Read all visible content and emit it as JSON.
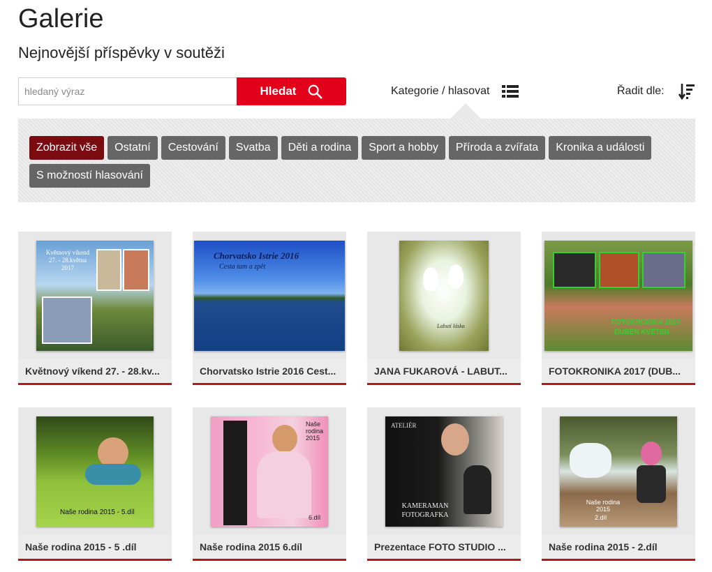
{
  "header": {
    "title": "Galerie",
    "subtitle": "Nejnovější příspěvky v soutěži"
  },
  "search": {
    "placeholder": "hledaný výraz",
    "value": "",
    "button_label": "Hledat"
  },
  "category_toggle": {
    "label": "Kategorie / hlasovat",
    "icon": "list-icon"
  },
  "sort": {
    "label": "Řadit dle:",
    "icon": "sort-descending-icon"
  },
  "filters": {
    "row1": [
      "Zobrazit vše",
      "Ostatní",
      "Cestování",
      "Svatba",
      "Děti a rodina",
      "Sport a hobby",
      "Příroda a zvířata",
      "Kronika a události"
    ],
    "row2": [
      "S možností hlasování"
    ],
    "active": "Zobrazit vše",
    "active_color": "#7a0b10",
    "chip_color": "#666666"
  },
  "colors": {
    "accent": "#e3001b",
    "card_underline": "#b01a1f"
  },
  "gallery": [
    {
      "caption": "Květnový víkend 27. - 28.kv...",
      "thumb_text": "Květnový víkend 27. - 28.května 2017"
    },
    {
      "caption": "Chorvatsko Istrie 2016 Cest...",
      "thumb_text": "Chorvatsko Istrie 2016",
      "thumb_subtext": "Cesta tam a zpět"
    },
    {
      "caption": "JANA FUKAROVÁ - LABUT...",
      "thumb_text": "Labutí láska"
    },
    {
      "caption": "FOTOKRONIKA 2017 (DUB...",
      "thumb_text": "FOTOKRONIKA 2017",
      "thumb_subtext": "DUBEN KVĚTEN"
    },
    {
      "caption": "Naše rodina 2015 - 5 .díl",
      "thumb_text": "Naše rodina 2015 - 5.díl"
    },
    {
      "caption": "Naše rodina 2015 6.díl",
      "thumb_text": "Naše rodina 2015",
      "thumb_subtext": "6.díl"
    },
    {
      "caption": "Prezentace FOTO STUDIO ...",
      "thumb_text": "KAMERAMAN FOTOGRAFKA",
      "thumb_subtext": "ATELIÉR"
    },
    {
      "caption": "Naše rodina 2015 - 2.díl",
      "thumb_text": "Naše rodina 2015",
      "thumb_subtext": "2.díl"
    }
  ]
}
